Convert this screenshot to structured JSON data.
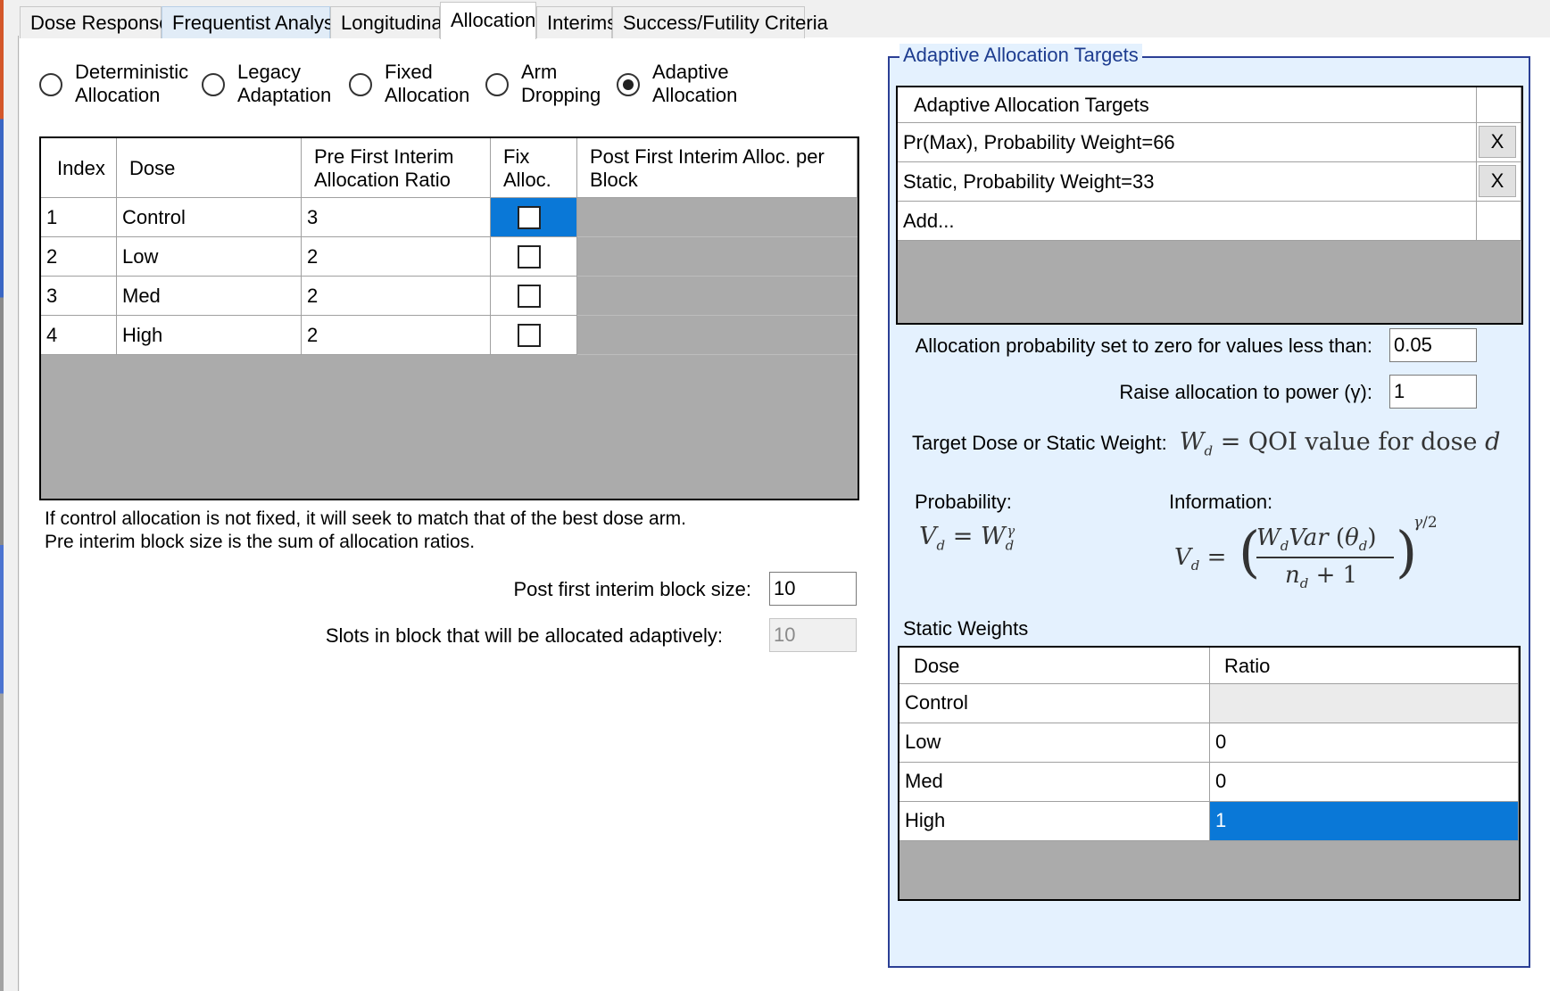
{
  "tabs": [
    {
      "label": "Dose Response"
    },
    {
      "label": "Frequentist Analysis"
    },
    {
      "label": "Longitudinal"
    },
    {
      "label": "Allocation"
    },
    {
      "label": "Interims"
    },
    {
      "label": "Success/Futility Criteria"
    }
  ],
  "selected_tab": "Allocation",
  "allocation_modes": [
    {
      "line1": "Deterministic",
      "line2": "Allocation",
      "checked": false
    },
    {
      "line1": "Legacy",
      "line2": "Adaptation",
      "checked": false
    },
    {
      "line1": "Fixed",
      "line2": "Allocation",
      "checked": false
    },
    {
      "line1": "Arm",
      "line2": "Dropping",
      "checked": false
    },
    {
      "line1": "Adaptive",
      "line2": "Allocation",
      "checked": true
    }
  ],
  "dose_grid": {
    "headers": {
      "index": "Index",
      "dose": "Dose",
      "pre_ratio_l1": "Pre First Interim",
      "pre_ratio_l2": "Allocation Ratio",
      "fix_l1": "Fix",
      "fix_l2": "Alloc.",
      "post_l1": "Post First Interim Alloc. per",
      "post_l2": "Block"
    },
    "rows": [
      {
        "index": "1",
        "dose": "Control",
        "ratio": "3",
        "fixed": false
      },
      {
        "index": "2",
        "dose": "Low",
        "ratio": "2",
        "fixed": false
      },
      {
        "index": "3",
        "dose": "Med",
        "ratio": "2",
        "fixed": false
      },
      {
        "index": "4",
        "dose": "High",
        "ratio": "2",
        "fixed": false
      }
    ]
  },
  "notes": {
    "line1": "If control allocation is not fixed, it will seek to match that of the best dose arm.",
    "line2": "Pre interim block size is the sum of allocation ratios."
  },
  "block": {
    "post_label": "Post first interim block size:",
    "post_value": "10",
    "slots_label": "Slots in block that will be allocated adaptively:",
    "slots_value": "10"
  },
  "adaptive_targets": {
    "group_title": "Adaptive Allocation Targets",
    "grid_header": "Adaptive Allocation Targets",
    "items": [
      {
        "label": "Pr(Max), Probability Weight=66",
        "remove": "X"
      },
      {
        "label": "Static, Probability Weight=33",
        "remove": "X"
      }
    ],
    "add_label": "Add...",
    "zero_label": "Allocation probability set to zero for values less than:",
    "zero_value": "0.05",
    "power_label": "Raise allocation to power (γ):",
    "power_value": "1",
    "target_label": "Target Dose or Static Weight:",
    "target_formula": "= QOI value for dose",
    "probability_label": "Probability:",
    "information_label": "Information:"
  },
  "static_weights": {
    "title": "Static Weights",
    "headers": {
      "dose": "Dose",
      "ratio": "Ratio"
    },
    "rows": [
      {
        "dose": "Control",
        "ratio": ""
      },
      {
        "dose": "Low",
        "ratio": "0"
      },
      {
        "dose": "Med",
        "ratio": "0"
      },
      {
        "dose": "High",
        "ratio": "1"
      }
    ]
  },
  "colors": {
    "group_border": "#2b3f95",
    "group_bg": "#e4f1fe",
    "selection": "#0a78d7",
    "grid_empty": "#ababab"
  }
}
